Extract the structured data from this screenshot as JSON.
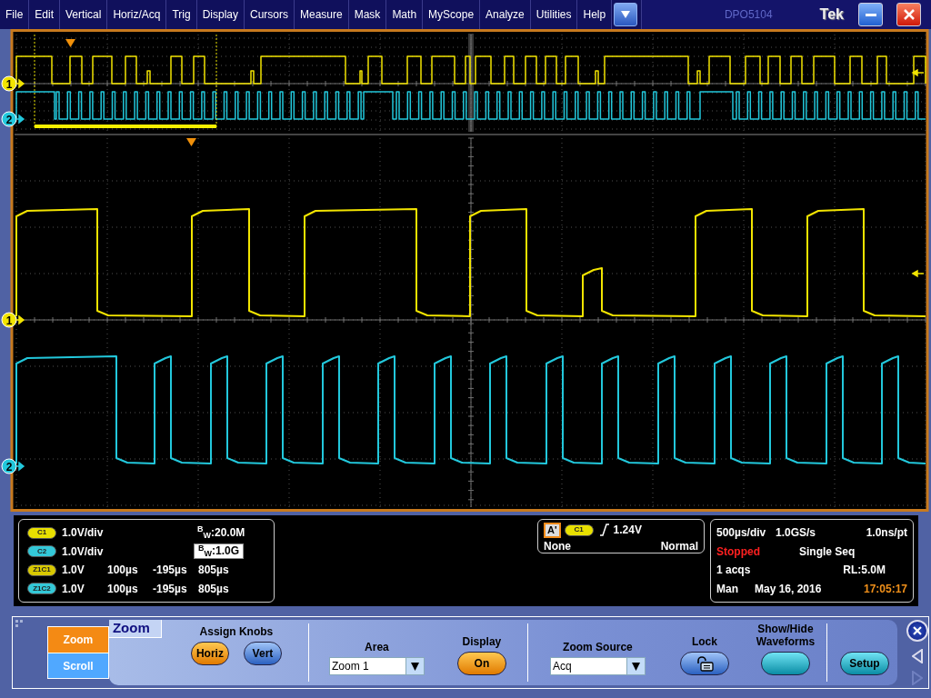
{
  "menu_bar": {
    "items": [
      "File",
      "Edit",
      "Vertical",
      "Horiz/Acq",
      "Trig",
      "Display",
      "Cursors",
      "Measure",
      "Mask",
      "Math",
      "MyScope",
      "Analyze",
      "Utilities",
      "Help"
    ],
    "model": "DPO5104",
    "brand": "Tek"
  },
  "overview": {
    "markers": [
      {
        "label": "1",
        "color": "#f2e400"
      },
      {
        "label": "2",
        "color": "#22c8dc"
      }
    ]
  },
  "zoom_pane": {
    "markers": [
      {
        "label": "1",
        "color": "#f2e400"
      },
      {
        "label": "2",
        "color": "#22c8dc"
      }
    ]
  },
  "vertical_readout": {
    "rows": [
      {
        "kind": "channel",
        "badge": "C1",
        "color": "#e8e000",
        "scale": "1.0V/div",
        "bandwidth": "$^{B}$$_{W}$:20.0M",
        "selected": false
      },
      {
        "kind": "channel",
        "badge": "C2",
        "color": "#33c8d8",
        "scale": "1.0V/div",
        "bandwidth": "$^{B}$$_{W}$:1.0G",
        "selected": true
      },
      {
        "kind": "zoom",
        "badge": "Z1C1",
        "color": "#d8c800",
        "scale": "1.0V",
        "position": "100µs",
        "start": "-195µs",
        "end": "805µs"
      },
      {
        "kind": "zoom",
        "badge": "Z1C2",
        "color": "#33c8d8",
        "scale": "1.0V",
        "position": "100µs",
        "start": "-195µs",
        "end": "805µs"
      }
    ]
  },
  "trigger_readout": {
    "event": "A'",
    "source": {
      "label": "C1",
      "color": "#e8e000"
    },
    "threshold": "1.24V",
    "coupling": "None",
    "mode": "Normal"
  },
  "acquisition_readout": {
    "timebase": "500µs/div",
    "sample_rate": "1.0GS/s",
    "resolution": "1.0ns/pt",
    "state": "Stopped",
    "mode": "Single Seq",
    "acqs": "1 acqs",
    "record_length": "RL:5.0M",
    "trigger": "Man",
    "date": "May 16, 2016",
    "time": "17:05:17"
  },
  "control_panel": {
    "title": "Zoom",
    "mode_buttons": [
      {
        "label": "Zoom",
        "selected": true
      },
      {
        "label": "Scroll",
        "selected": false
      }
    ],
    "assign_knobs": {
      "label": "Assign Knobs",
      "buttons": [
        {
          "label": "Horiz",
          "selected": true
        },
        {
          "label": "Vert",
          "selected": false
        }
      ]
    },
    "area": {
      "label": "Area",
      "value": "Zoom 1"
    },
    "display": {
      "label": "Display",
      "button": "On",
      "on": true
    },
    "zoom_source": {
      "label": "Zoom Source",
      "value": "Acq"
    },
    "lock": {
      "label": "Lock"
    },
    "show_hide": {
      "label": "Show/Hide Waveforms"
    },
    "setup_button": "Setup"
  }
}
